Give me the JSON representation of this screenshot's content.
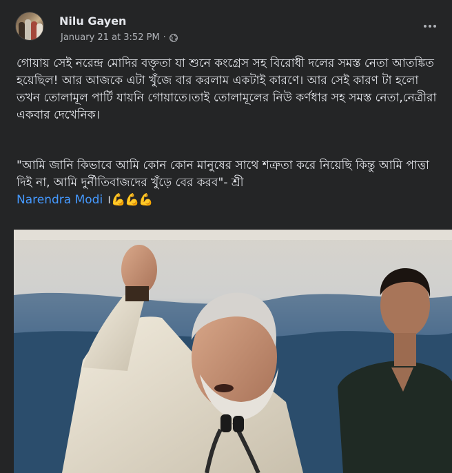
{
  "post": {
    "author": "Nilu Gayen",
    "timestamp": "January 21 at 3:52 PM",
    "separator": "·",
    "privacy_icon": "globe-icon",
    "more_icon": "more-horizontal-icon",
    "body": "গোয়ায় সেই নরেন্দ্র মোদির বক্তৃতা যা শুনে কংগ্রেস সহ বিরোধী দলের সমস্ত নেতা আতঙ্কিত হয়েছিল! আর আজকে এটা খুঁজে বার করলাম একটাই কারণে। আর সেই কারণ টা হলো তখন তোলামূল পার্টি যায়নি গোয়াতে।তাই তোলামূলের নিউ কর্ণধার সহ সমস্ত নেতা,নেত্রীরা একবার দেখেনিক।",
    "quote": "\"আমি জানি কিভাবে আমি কোন কোন মানুষের সাথে শত্রুতা করে নিয়েছি কিন্তু আমি পাত্তা দিই না, আমি দুর্নীতিবাজদের খুঁড়ে বের করব\"- শ্রী",
    "mention": "Narendra Modi",
    "quote_end": " ।",
    "emoji": "💪💪💪"
  },
  "colors": {
    "background": "#242526",
    "primary_text": "#e4e6eb",
    "secondary_text": "#b0b3b8",
    "link": "#4599ff"
  },
  "media": {
    "type": "video-frame"
  }
}
